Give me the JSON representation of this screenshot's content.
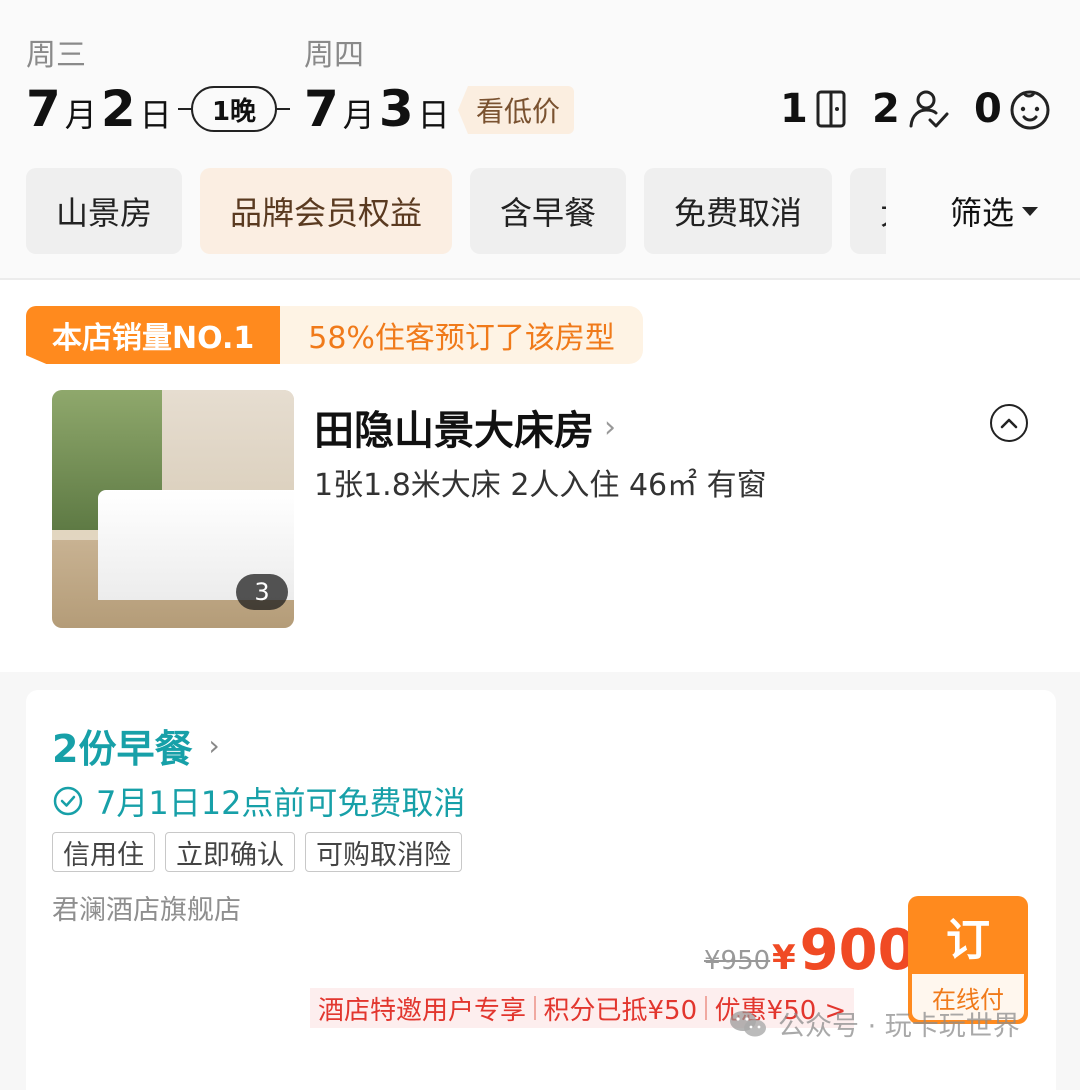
{
  "header": {
    "checkin": {
      "weekday": "周三",
      "month": "7",
      "month_unit": "月",
      "day": "2",
      "day_unit": "日"
    },
    "nights_label": "1晚",
    "checkout": {
      "weekday": "周四",
      "month": "7",
      "month_unit": "月",
      "day": "3",
      "day_unit": "日"
    },
    "low_price_label": "看低价",
    "rooms_count": "1",
    "adults_count": "2",
    "children_count": "0"
  },
  "filters": {
    "chips": [
      "山景房",
      "品牌会员权益",
      "含早餐",
      "免费取消",
      "大"
    ],
    "filter_label": "筛选"
  },
  "room": {
    "banner_badge": "本店销量NO.1",
    "banner_text": "58%住客预订了该房型",
    "photo_count": "3",
    "name": "田隐山景大床房",
    "info": "1张1.8米大床  2人入住  46㎡  有窗"
  },
  "offer": {
    "breakfast": "2份早餐",
    "cancel_policy": "7月1日12点前可免费取消",
    "tags": [
      "信用住",
      "立即确认",
      "可购取消险"
    ],
    "shop": "君澜酒店旗舰店",
    "original_price": "¥950",
    "currency": "¥",
    "price": "900",
    "book_label": "订",
    "pay_label": "在线付",
    "promos": [
      "酒店特邀用户专享",
      "积分已抵¥50",
      "优惠¥50 >"
    ]
  },
  "watermark": "公众号 · 玩卡玩世界",
  "colors": {
    "accent_orange": "#ff8a1e",
    "teal": "#17a0a8",
    "price_red": "#f04a24"
  }
}
